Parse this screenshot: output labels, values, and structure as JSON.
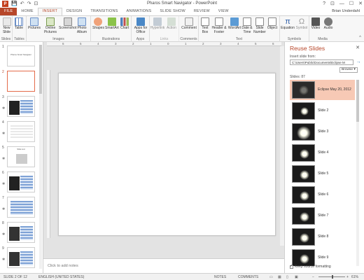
{
  "window": {
    "title": "Pharos Smart Navigator - PowerPoint",
    "controls": [
      "?",
      "⊡",
      "—",
      "☐",
      "✕"
    ],
    "user": "Brian Underdahl"
  },
  "qat": {
    "app_icon": "P",
    "save": "💾",
    "undo": "↶",
    "redo": "↷",
    "start": "⊡"
  },
  "tabs": [
    "FILE",
    "HOME",
    "INSERT",
    "DESIGN",
    "TRANSITIONS",
    "ANIMATIONS",
    "SLIDE SHOW",
    "REVIEW",
    "VIEW"
  ],
  "ribbon": {
    "groups": [
      {
        "label": "Slides",
        "buttons": [
          "New Slide"
        ]
      },
      {
        "label": "Tables",
        "buttons": [
          "Table"
        ]
      },
      {
        "label": "Images",
        "buttons": [
          "Pictures",
          "Online Pictures",
          "Screenshot",
          "Photo Album"
        ]
      },
      {
        "label": "Illustrations",
        "buttons": [
          "Shapes",
          "SmartArt",
          "Chart"
        ]
      },
      {
        "label": "Apps",
        "buttons": [
          "Apps for Office"
        ]
      },
      {
        "label": "Links",
        "buttons": [
          "Hyperlink",
          "Action"
        ]
      },
      {
        "label": "Comments",
        "buttons": [
          "Comment"
        ]
      },
      {
        "label": "Text",
        "buttons": [
          "Text Box",
          "Header & Footer",
          "WordArt",
          "Date & Time",
          "Slide Number",
          "Object"
        ]
      },
      {
        "label": "Symbols",
        "buttons": [
          "Equation",
          "Symbol"
        ]
      },
      {
        "label": "Media",
        "buttons": [
          "Video",
          "Audio"
        ]
      }
    ],
    "collapse": "^"
  },
  "thumbnails": [
    {
      "num": "1",
      "text": "Pharos Smart Navigator",
      "kind": "title"
    },
    {
      "num": "2",
      "text": "",
      "kind": "blank",
      "selected": true
    },
    {
      "num": "3",
      "text": "",
      "kind": "dark"
    },
    {
      "num": "4",
      "text": "",
      "kind": "bars"
    },
    {
      "num": "5",
      "text": "Slide text",
      "kind": "title"
    },
    {
      "num": "6",
      "text": "",
      "kind": "bars"
    },
    {
      "num": "7",
      "text": "",
      "kind": "bars"
    },
    {
      "num": "8",
      "text": "",
      "kind": "dark"
    },
    {
      "num": "9",
      "text": "",
      "kind": "dark"
    }
  ],
  "ruler": {
    "marks": [
      "6",
      "5",
      "4",
      "3",
      "2",
      "1",
      "0",
      "1",
      "2",
      "3",
      "4",
      "5",
      "6"
    ]
  },
  "notes": {
    "placeholder": "Click to add notes"
  },
  "reuse": {
    "title": "Reuse Slides",
    "close": "✕",
    "insert_from_label": "Insert slide from:",
    "source_path": "C:\\Users\\Public\\Documents\\Eclipse M",
    "go": "→",
    "browse": "Browse ▾",
    "slides_count": "Slides: 87",
    "slides": [
      {
        "name": "Eclipse May 20, 2012",
        "selected": true
      },
      {
        "name": "Slide 2"
      },
      {
        "name": "Slide 3"
      },
      {
        "name": "Slide 4"
      },
      {
        "name": "Slide 5"
      },
      {
        "name": "Slide 6"
      },
      {
        "name": "Slide 7"
      },
      {
        "name": "Slide 8"
      },
      {
        "name": "Slide 9"
      }
    ],
    "keep_formatting": "Keep source formatting"
  },
  "status": {
    "slide": "SLIDE 2 OF 12",
    "language": "ENGLISH (UNITED STATES)",
    "notes": "NOTES",
    "comments": "COMMENTS",
    "zoom": "61%"
  },
  "colors": {
    "accent": "#b7472a",
    "selected_slide_bg": "#f7c9b5"
  }
}
